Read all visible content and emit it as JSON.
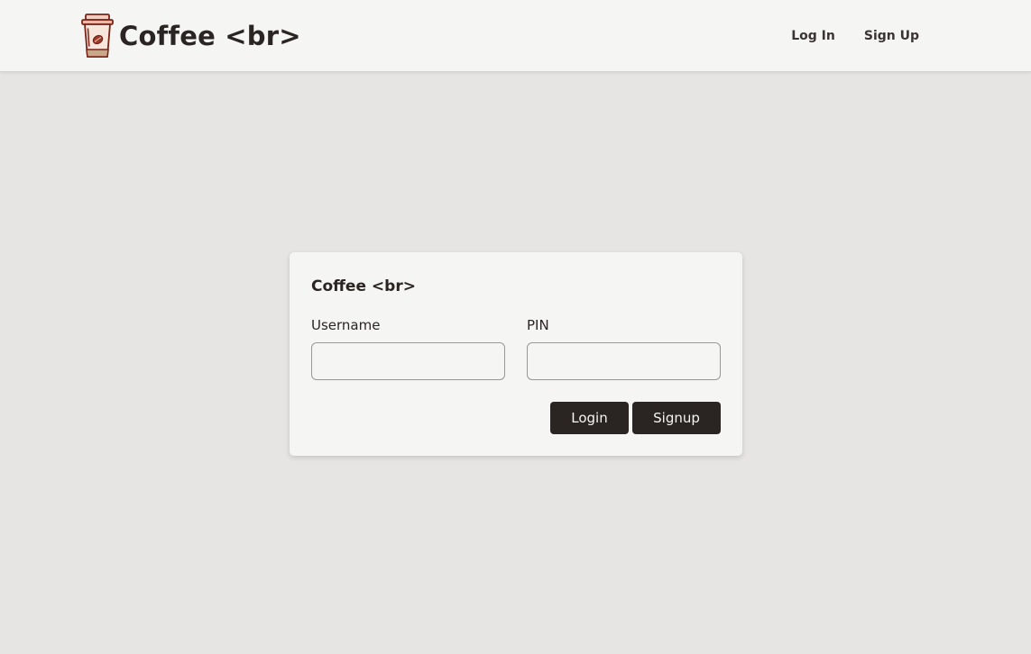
{
  "navbar": {
    "brand_name": "Coffee <br>",
    "brand_icon": "coffee-cup-icon",
    "links": [
      {
        "label": "Log In"
      },
      {
        "label": "Sign Up"
      }
    ]
  },
  "login_card": {
    "title": "Coffee <br>",
    "username": {
      "label": "Username",
      "value": "",
      "placeholder": ""
    },
    "pin": {
      "label": "PIN",
      "value": "",
      "placeholder": ""
    },
    "login_button": "Login",
    "signup_button": "Signup"
  },
  "colors": {
    "page_background": "#e6e5e3",
    "surface": "#f5f5f3",
    "text_dark": "#2a2523",
    "button_background": "#2a2523",
    "button_text": "#f5f5f3",
    "cup_accent": "#8c2a1c",
    "cup_sleeve": "#c9a88a"
  }
}
